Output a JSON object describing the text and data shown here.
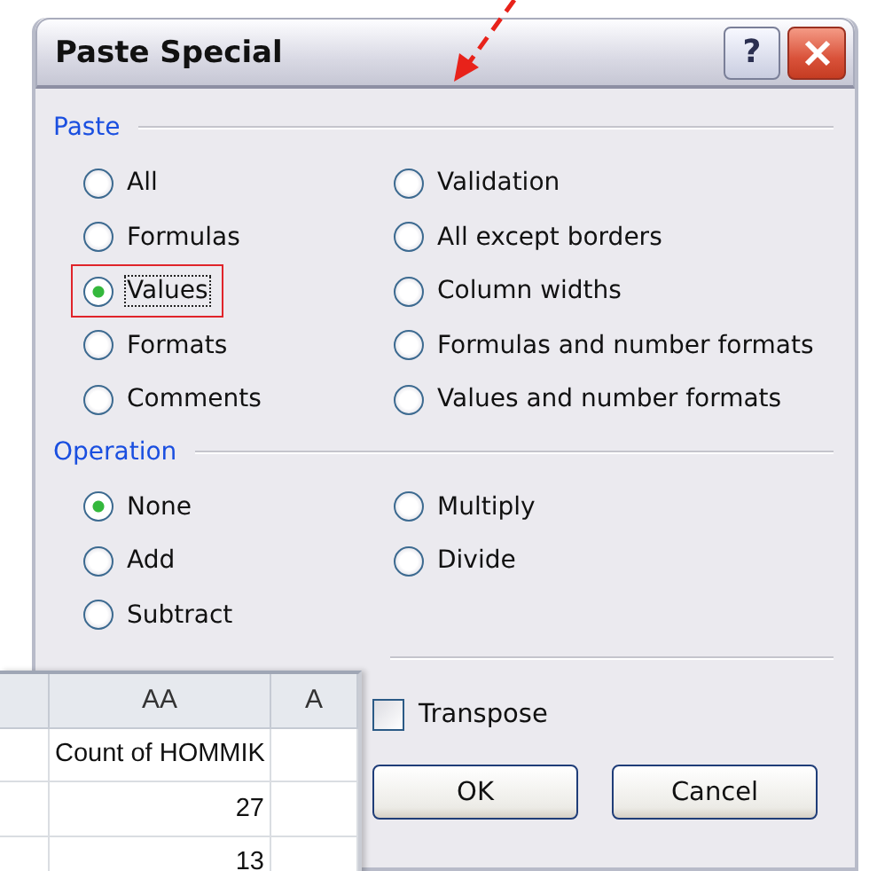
{
  "window": {
    "title": "Paste Special",
    "help_button": "?"
  },
  "paste": {
    "label": "Paste",
    "options": [
      {
        "label": "All",
        "selected": false,
        "highlighted": false
      },
      {
        "label": "Formulas",
        "selected": false,
        "highlighted": false
      },
      {
        "label": "Values",
        "selected": true,
        "highlighted": true
      },
      {
        "label": "Formats",
        "selected": false,
        "highlighted": false
      },
      {
        "label": "Comments",
        "selected": false,
        "highlighted": false
      },
      {
        "label": "Validation",
        "selected": false,
        "highlighted": false
      },
      {
        "label": "All except borders",
        "selected": false,
        "highlighted": false
      },
      {
        "label": "Column widths",
        "selected": false,
        "highlighted": false
      },
      {
        "label": "Formulas and number formats",
        "selected": false,
        "highlighted": false
      },
      {
        "label": "Values and number formats",
        "selected": false,
        "highlighted": false
      }
    ]
  },
  "operation": {
    "label": "Operation",
    "options": [
      {
        "label": "None",
        "selected": true,
        "highlighted": false
      },
      {
        "label": "Add",
        "selected": false,
        "highlighted": false
      },
      {
        "label": "Subtract",
        "selected": false,
        "highlighted": false
      },
      {
        "label": "Multiply",
        "selected": false,
        "highlighted": false
      },
      {
        "label": "Divide",
        "selected": false,
        "highlighted": false
      }
    ]
  },
  "transpose": {
    "label": "Transpose",
    "checked": false
  },
  "buttons": [
    "OK",
    "Cancel"
  ],
  "spreadsheet": {
    "columns": [
      "",
      "AA",
      "A"
    ],
    "rows": [
      [
        "",
        "Count of HOMMIK",
        ""
      ],
      [
        "",
        "27",
        ""
      ],
      [
        "",
        "13",
        ""
      ]
    ]
  }
}
